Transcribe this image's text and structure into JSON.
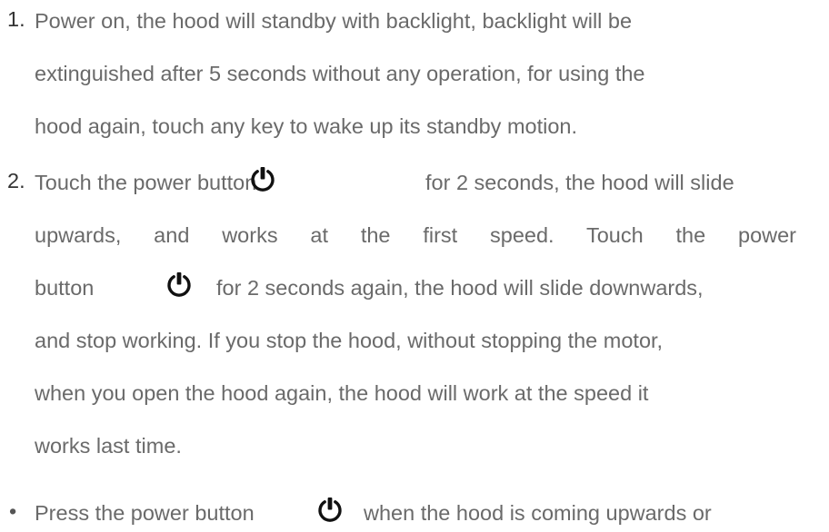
{
  "items": [
    {
      "marker": "1.",
      "lines": [
        "Power on, the hood will standby with backlight, backlight will be",
        "extinguished after 5 seconds without any operation, for using the",
        "hood again, touch any key to wake up its standby motion."
      ]
    },
    {
      "marker": "2.",
      "line1_a": "Touch the power button",
      "line1_b": "for 2 seconds, the hood will slide",
      "line2": "upwards, and works at the first speed. Touch the power",
      "line3_a": "button",
      "line3_b": "for 2 seconds again, the hood will slide downwards,",
      "line4": "and stop working. If you stop the hood, without stopping the motor,",
      "line5": "when you open the hood again, the hood will work at the speed it",
      "line6": "works last time."
    },
    {
      "marker": "•",
      "line1_a": "Press the power button",
      "line1_b": "when the hood is coming upwards or"
    }
  ],
  "icons": {
    "power": "power-icon"
  }
}
